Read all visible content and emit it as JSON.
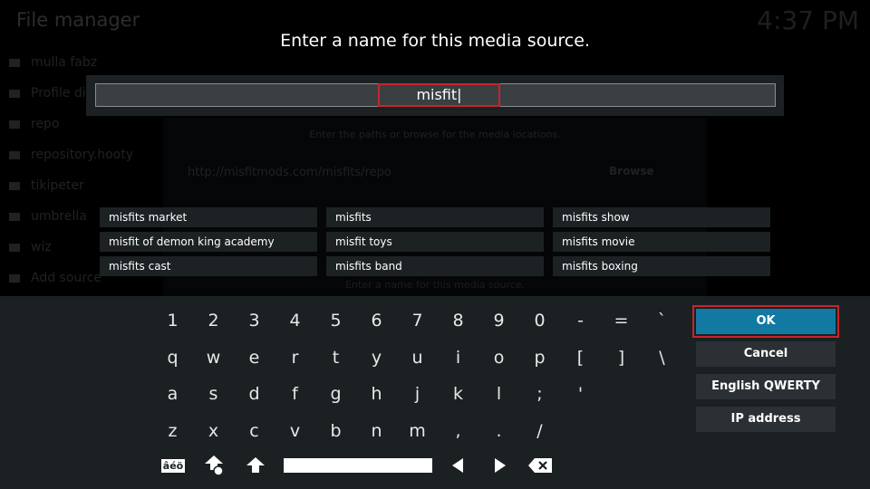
{
  "background": {
    "title": "File manager",
    "clock": "4:37 PM",
    "sidebar": [
      "mulla fabz",
      "Profile di",
      "repo",
      "repository.hooty",
      "tikipeter",
      "umbrella",
      "wiz",
      "Add source"
    ],
    "dialog": {
      "hint": "Enter the paths or browse for the media locations.",
      "path": "http://misfitmods.com/misfits/repo",
      "browse": "Browse",
      "name_hint": "Enter a name for this media source."
    }
  },
  "heading": "Enter a name for this media source.",
  "input": {
    "value": "misfit|"
  },
  "suggestions": [
    "misfits market",
    "misfits",
    "misfits show",
    "misfit of demon king academy",
    "misfit toys",
    "misfits movie",
    "misfits cast",
    "misfits band",
    "misfits boxing"
  ],
  "keys": [
    [
      "1",
      "2",
      "3",
      "4",
      "5",
      "6",
      "7",
      "8",
      "9",
      "0",
      "-",
      "=",
      "`"
    ],
    [
      "q",
      "w",
      "e",
      "r",
      "t",
      "y",
      "u",
      "i",
      "o",
      "p",
      "[",
      "]",
      "\\"
    ],
    [
      "a",
      "s",
      "d",
      "f",
      "g",
      "h",
      "j",
      "k",
      "l",
      ";",
      "'",
      "",
      ""
    ],
    [
      "z",
      "x",
      "c",
      "v",
      "b",
      "n",
      "m",
      ",",
      ".",
      "/",
      "",
      "",
      ""
    ]
  ],
  "bottom": {
    "symbols": "âéö"
  },
  "buttons": {
    "ok": "OK",
    "cancel": "Cancel",
    "layout": "English QWERTY",
    "ip": "IP address"
  },
  "colors": {
    "accent": "#127aa2",
    "focus": "#c8252b"
  }
}
